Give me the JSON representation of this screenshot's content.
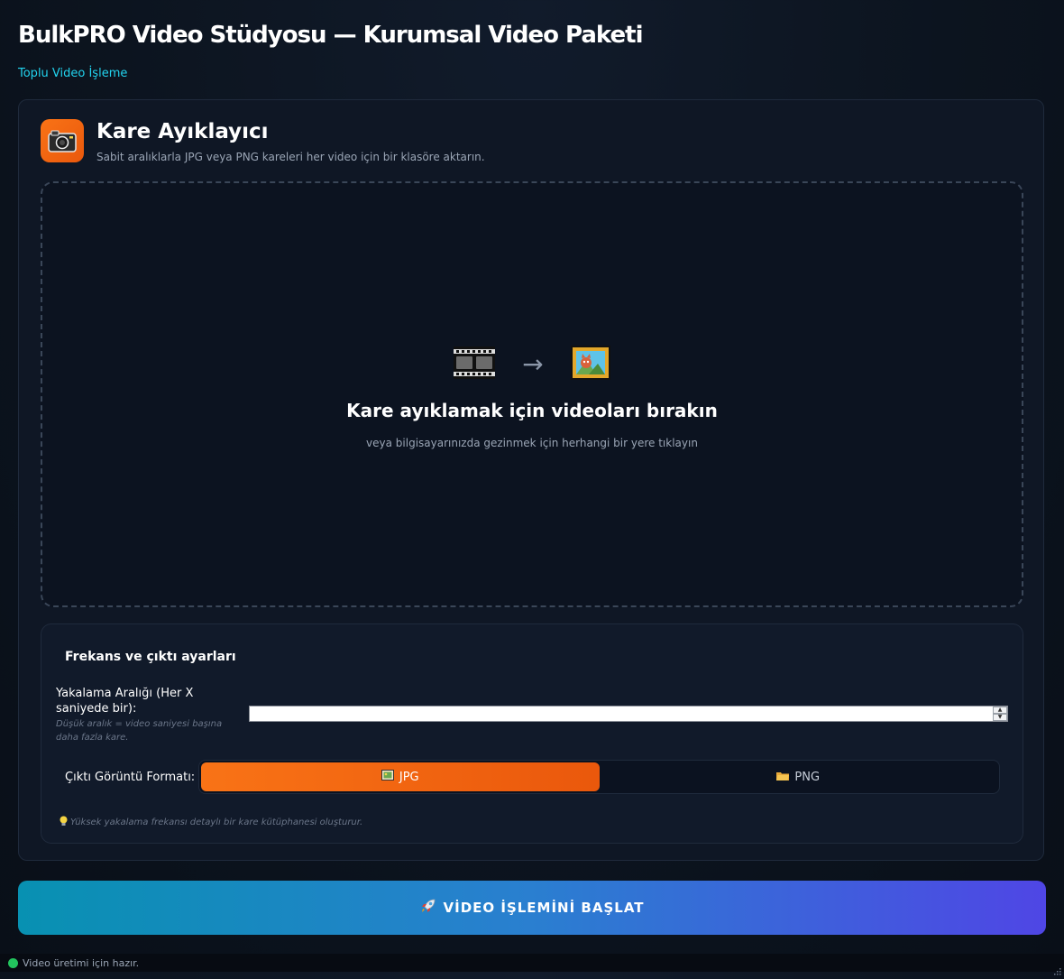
{
  "header": {
    "title": "BulkPRO Video Stüdyosu — Kurumsal Video Paketi",
    "subtitle": "Toplu Video İşleme"
  },
  "tool": {
    "icon": "camera-icon",
    "title": "Kare Ayıklayıcı",
    "description": "Sabit aralıklarla JPG veya PNG kareleri her video için bir klasöre aktarın."
  },
  "dropzone": {
    "icons": [
      "film-strip-icon",
      "arrow-right-icon",
      "framed-picture-icon"
    ],
    "arrow": "→",
    "title": "Kare ayıklamak için videoları bırakın",
    "subtitle": "veya bilgisayarınızda gezinmek için herhangi bir yere tıklayın"
  },
  "settings": {
    "title": "Frekans ve çıktı ayarları",
    "interval_label": "Yakalama Aralığı (Her X saniyede bir):",
    "interval_hint": "Düşük aralık = video saniyesi başına daha fazla kare.",
    "interval_value": "",
    "format_label": "Çıktı Görüntü Formatı:",
    "formats": [
      {
        "label": "JPG",
        "icon": "image-file-icon",
        "active": true
      },
      {
        "label": "PNG",
        "icon": "folder-icon",
        "active": false
      }
    ],
    "tip": "Yüksek yakalama frekansı detaylı bir kare kütüphanesi oluşturur.",
    "tip_icon": "lightbulb-icon"
  },
  "start_button": {
    "label": "VİDEO İŞLEMİNİ BAŞLAT",
    "icon": "rocket-icon"
  },
  "status": {
    "text": "Video üretimi için hazır.",
    "color": "#22c55e"
  },
  "colors": {
    "accent_orange": "#f97316",
    "accent_cyan": "#22d3ee",
    "gradient_start": "#0891b2",
    "gradient_end": "#4f46e5",
    "background": "#0c141f"
  }
}
